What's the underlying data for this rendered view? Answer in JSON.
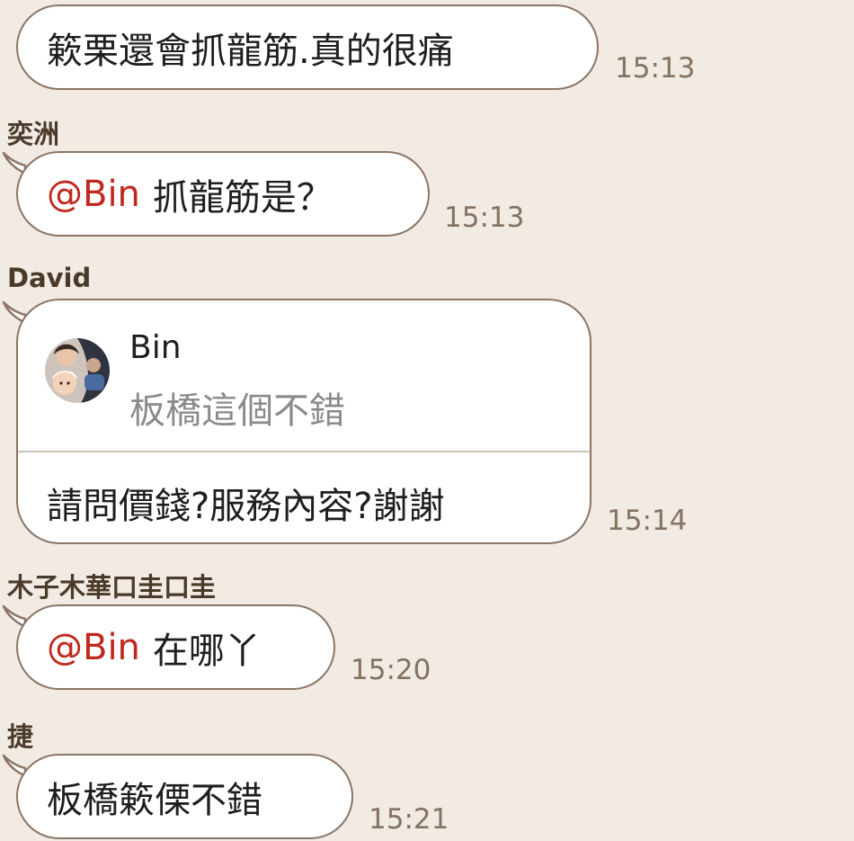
{
  "messages": [
    {
      "sender": "",
      "text": "簌栗還會抓龍筋.真的很痛",
      "time": "15:13"
    },
    {
      "sender": "奕洲",
      "mention": "@Bin",
      "text": "抓龍筋是？",
      "time": "15:13"
    },
    {
      "sender": "David",
      "quote": {
        "name": "Bin",
        "text": "板橋這個不錯"
      },
      "text": "請問價錢?服務內容?謝謝",
      "time": "15:14"
    },
    {
      "sender": "木子木華口圭口圭",
      "mention": "@Bin",
      "text": "在哪丫",
      "time": "15:20"
    },
    {
      "sender": "捷",
      "text": "板橋簌傈不錯",
      "time": "15:21"
    }
  ],
  "colors": {
    "background": "#f1ebe4",
    "bubble_border": "#8c7565",
    "mention": "#c0281e",
    "timestamp": "#847262"
  }
}
